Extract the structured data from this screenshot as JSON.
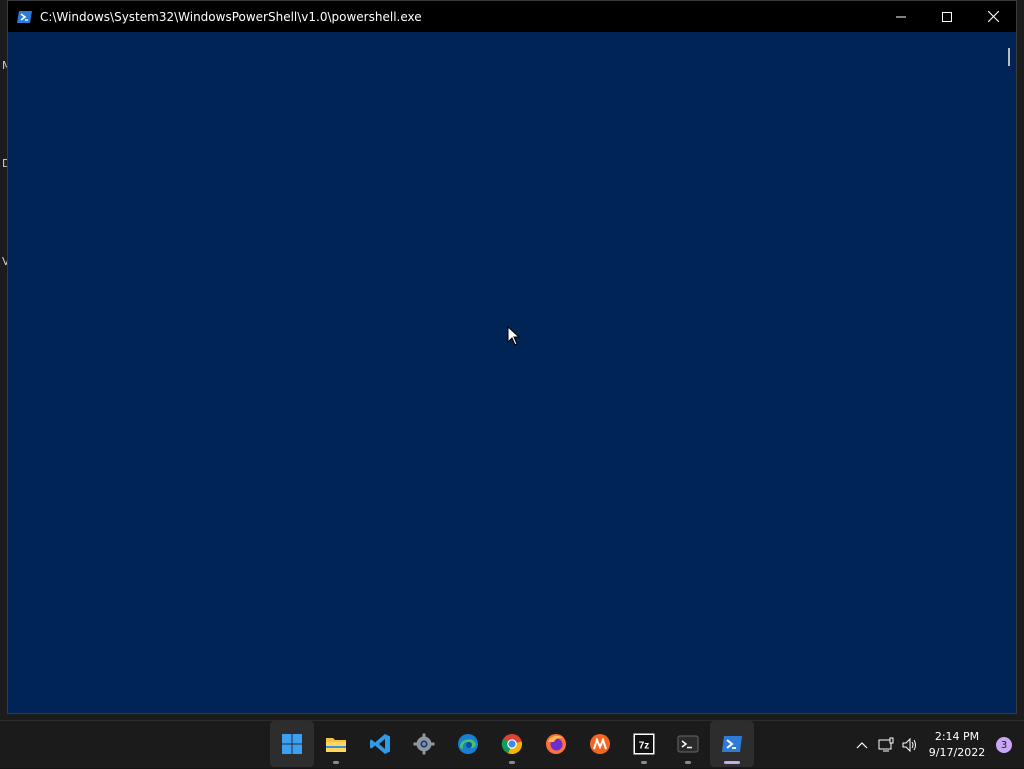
{
  "window": {
    "title": "C:\\Windows\\System32\\WindowsPowerShell\\v1.0\\powershell.exe",
    "app_icon": "powershell-icon",
    "console_bg": "#012456",
    "controls": {
      "minimize": "minimize-icon",
      "maximize": "maximize-icon",
      "close": "close-icon"
    }
  },
  "desktop": {
    "peek_letters": [
      "M",
      "D",
      "V"
    ]
  },
  "taskbar": {
    "apps": [
      {
        "name": "start",
        "icon": "windows-start-icon",
        "running": false,
        "active": true
      },
      {
        "name": "file-explorer",
        "icon": "folder-icon",
        "running": true,
        "active": false
      },
      {
        "name": "vscode",
        "icon": "vscode-icon",
        "running": false,
        "active": false
      },
      {
        "name": "settings",
        "icon": "gear-icon",
        "running": false,
        "active": false
      },
      {
        "name": "edge",
        "icon": "edge-icon",
        "running": false,
        "active": false
      },
      {
        "name": "chrome",
        "icon": "chrome-icon",
        "running": true,
        "active": false
      },
      {
        "name": "firefox",
        "icon": "firefox-icon",
        "running": false,
        "active": false
      },
      {
        "name": "orange-app",
        "icon": "orange-app-icon",
        "running": false,
        "active": false
      },
      {
        "name": "7zip",
        "icon": "7zip-icon",
        "label": "7z",
        "running": true,
        "active": false
      },
      {
        "name": "terminal",
        "icon": "terminal-icon",
        "running": true,
        "active": false
      },
      {
        "name": "powershell",
        "icon": "powershell-icon",
        "running": true,
        "active": true,
        "focused": true
      }
    ],
    "tray": {
      "chevron": "chevron-up-icon",
      "network": "network-icon",
      "volume": "volume-icon",
      "time": "2:14 PM",
      "date": "9/17/2022",
      "notification_count": "3"
    }
  }
}
